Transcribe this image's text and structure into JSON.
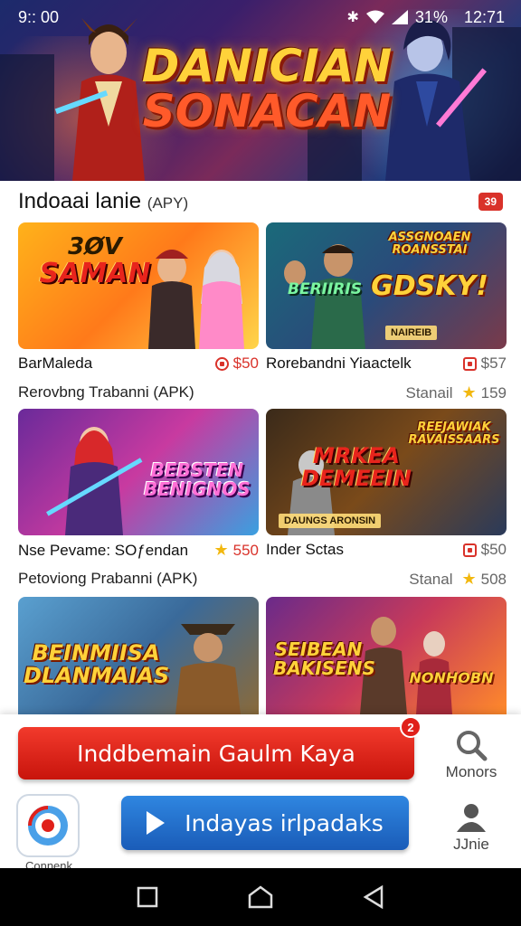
{
  "status_bar": {
    "time": "9:: 00",
    "battery": "31%",
    "clock": "12:71"
  },
  "hero": {
    "title_line1": "DANICIAN",
    "title_line2": "SONACAN"
  },
  "section": {
    "title": "Indoaai lanie",
    "title_suffix": "(APY)",
    "badge": "39"
  },
  "cards": [
    {
      "title_top": "3ØV",
      "title_main": "SAMAN",
      "style": "red"
    },
    {
      "title_top": "ASSGNOAEN ROANSSTAI",
      "title_main": "GDSKY!",
      "subtitle": "BERIIRIS",
      "tag": "NAIREIB",
      "style": "yellow"
    },
    {
      "title_main": "BEBSTEN BENIGNOS",
      "style": "pink"
    },
    {
      "title_top": "REEJAWIAK RAVAISSAARS",
      "title_main": "MRKEA DEMEEIN",
      "tag": "DAUNGS ARONSIN",
      "style": "red"
    },
    {
      "title_main": "BEINMIISA DLANMAIAS",
      "style": "yellow"
    },
    {
      "title_main": "SEIBEAN BAKISENS",
      "subtitle": "NONHOBN",
      "style": "yellow"
    }
  ],
  "rows": [
    {
      "left_name": "BarMaleda",
      "left_price": "$50",
      "right_name": "Rorebandni Yiaactelk",
      "right_price": "$57"
    },
    {
      "left_sub": "Rerovbng Trabanni (APK)",
      "right_label": "Stanail",
      "right_rating": "159"
    },
    {
      "left_name": "Nse Pevame: SOƒendan",
      "left_price": "550",
      "right_name": "Inder Sctas",
      "right_price": "$50"
    },
    {
      "left_sub": "Petoviong Prabanni (APK)",
      "right_label": "Stanal",
      "right_rating": "508"
    }
  ],
  "actions": {
    "primary_label": "Inddbemain Gaulm Kaya",
    "primary_badge": "2",
    "secondary_label": "Indayas irlpadaks",
    "search_label": "Monors",
    "user_label": "JJnie",
    "app_label": "Connenk"
  },
  "colors": {
    "accent_red": "#d9322a",
    "accent_blue": "#1a6fd0",
    "star": "#f2b80f"
  }
}
